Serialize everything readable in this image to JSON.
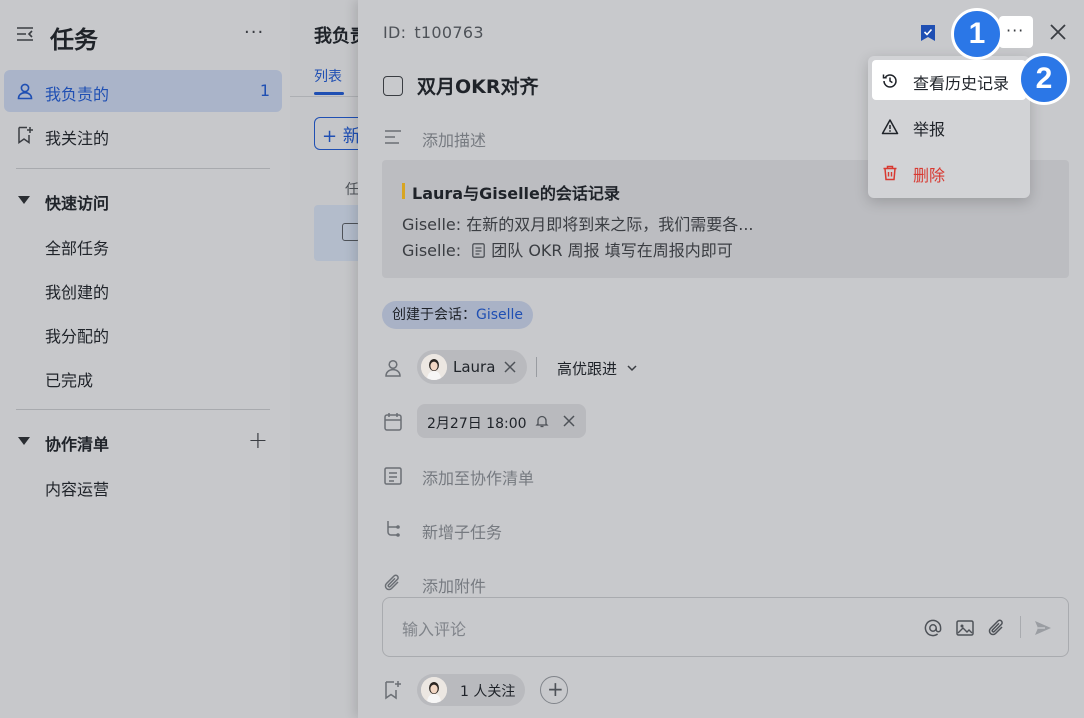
{
  "colors": {
    "accent": "#1f4fb3",
    "danger": "#d83931",
    "quote_bar": "#d8a521",
    "step_badge": "#2b77e7"
  },
  "sidebar": {
    "title": "任务",
    "more": "···",
    "items": [
      {
        "label": "我负责的",
        "count": "1",
        "icon": "person-icon",
        "active": true
      },
      {
        "label": "我关注的",
        "icon": "bookmark-add-icon"
      }
    ],
    "quick_access": {
      "label": "快速访问",
      "items": [
        "全部任务",
        "我创建的",
        "我分配的",
        "已完成"
      ]
    },
    "collab": {
      "label": "协作清单",
      "add": "+",
      "items": [
        "内容运营"
      ]
    }
  },
  "middle": {
    "title": "我负责",
    "tab": "列表",
    "new_button": "+ 新",
    "column_header": "任"
  },
  "detail": {
    "id_prefix": "ID:",
    "id_value": "t100763",
    "more": "···",
    "task_title": "双月OKR对齐",
    "description_placeholder": "添加描述",
    "chat_record": {
      "title": "Laura与Giselle的会话记录",
      "line1": "Giselle: 在新的双月即将到来之际，我们需要各...",
      "line2_prefix": "Giselle:",
      "line2_doc": "团队 OKR 周报 填写在周报内即可"
    },
    "source_prefix": "创建于会话：",
    "source_name": "Giselle",
    "assignee": "Laura",
    "priority": "高优跟进",
    "due": "2月27日 18:00",
    "add_to_list": "添加至协作清单",
    "add_subtask": "新增子任务",
    "add_attachment": "添加附件",
    "comment_placeholder": "输入评论",
    "followers": "1 人关注"
  },
  "menu": {
    "items": [
      {
        "label": "查看历史记录",
        "icon": "history-icon"
      },
      {
        "label": "举报",
        "icon": "warning-icon"
      },
      {
        "label": "删除",
        "icon": "trash-icon"
      }
    ]
  },
  "steps": [
    "1",
    "2"
  ]
}
